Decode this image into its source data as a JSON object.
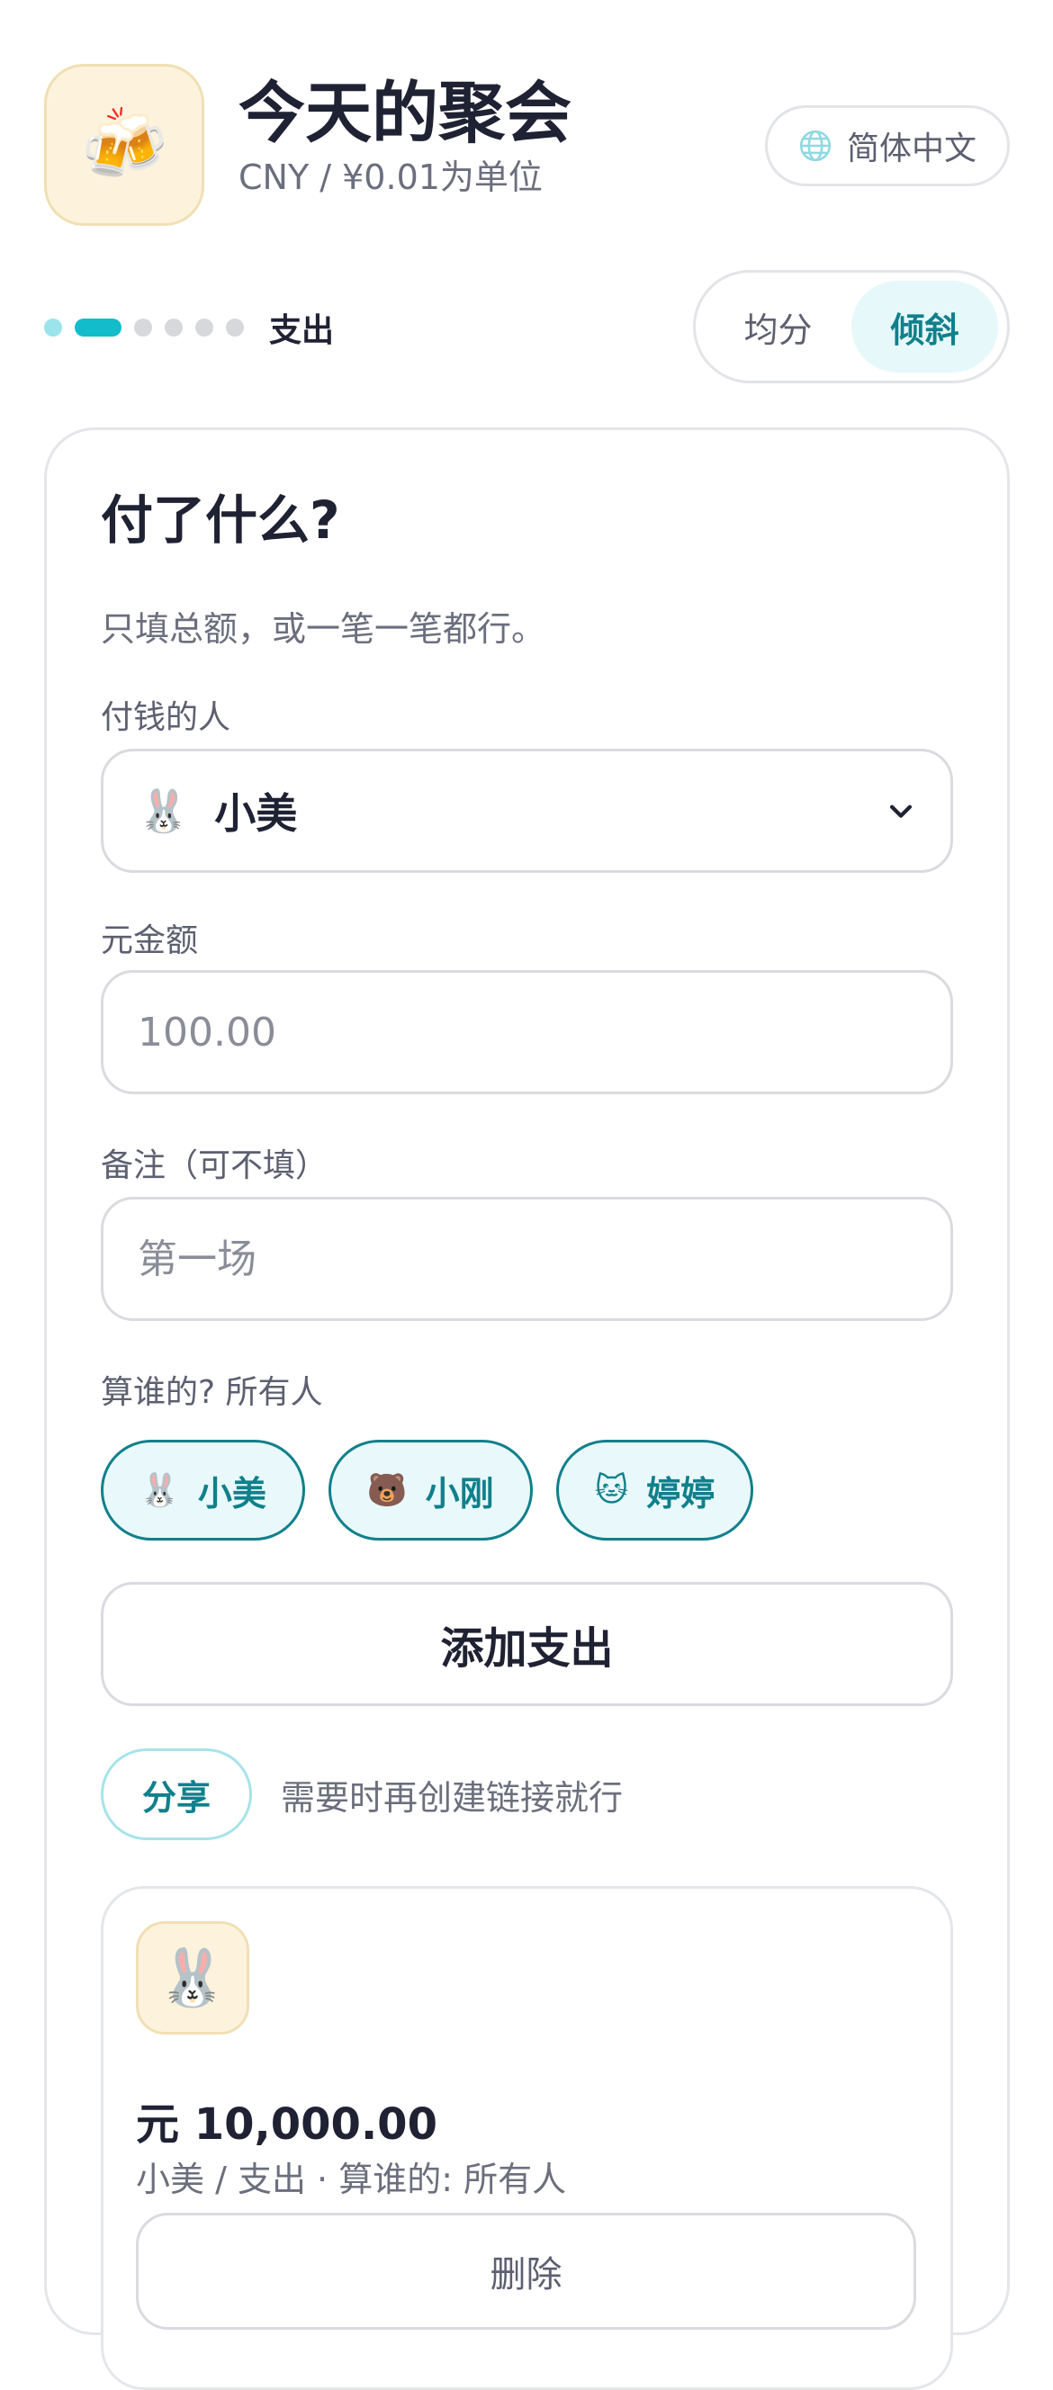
{
  "header": {
    "app_icon": "beer-mugs-icon",
    "app_emoji": "🍻",
    "title": "今天的聚会",
    "subtitle": "CNY / ¥0.01为单位",
    "language_label": "简体中文"
  },
  "progress": {
    "total_steps": 6,
    "current_step": 2,
    "step_label": "支出"
  },
  "split_mode": {
    "options": [
      "均分",
      "倾斜"
    ],
    "selected": "倾斜"
  },
  "form": {
    "title": "付了什么?",
    "description": "只填总额，或一笔一笔都行。",
    "payer_label": "付钱的人",
    "payer_emoji": "🐰",
    "payer_value": "小美",
    "amount_label": "元金额",
    "amount_placeholder": "100.00",
    "note_label": "备注（可不填）",
    "note_placeholder": "第一场",
    "participants_label": "算谁的? 所有人",
    "participants": [
      {
        "emoji": "🐰",
        "name": "小美"
      },
      {
        "emoji": "🐻",
        "name": "小刚"
      },
      {
        "emoji": "🐱",
        "name": "婷婷"
      }
    ],
    "add_button": "添加支出"
  },
  "share": {
    "button": "分享",
    "hint": "需要时再创建链接就行"
  },
  "expenses": [
    {
      "emoji": "🐰",
      "amount": "元 10,000.00",
      "meta": "小美 / 支出 · 算谁的: 所有人",
      "delete_label": "删除"
    }
  ],
  "colors": {
    "accent": "#10808b",
    "accent_light": "#e9f8fa",
    "progress_active": "#12bccb",
    "icon_bg": "#fdf3dd"
  }
}
